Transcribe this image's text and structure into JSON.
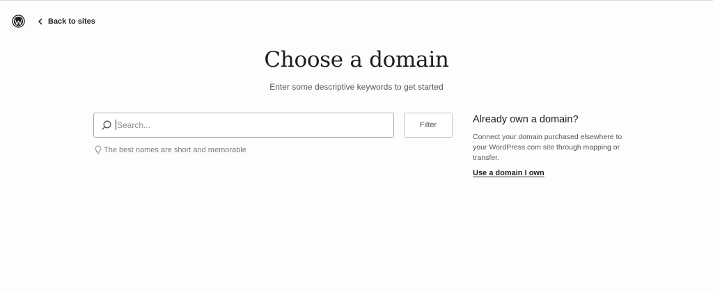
{
  "header": {
    "logo_icon": "wordpress-logo-icon",
    "back_icon": "chevron-left-icon",
    "back_label": "Back to sites"
  },
  "main": {
    "title": "Choose a domain",
    "subtitle": "Enter some descriptive keywords to get started",
    "search": {
      "icon": "search-icon",
      "value": "",
      "placeholder": "Search..."
    },
    "filter_label": "Filter",
    "hint": {
      "icon": "lightbulb-icon",
      "text": "The best names are short and memorable"
    }
  },
  "aside": {
    "title": "Already own a domain?",
    "description": "Connect your domain purchased elsewhere to your WordPress.com site through mapping or transfer.",
    "link_label": "Use a domain I own"
  },
  "colors": {
    "text": "#1e1e1e",
    "muted": "#50575e",
    "placeholder": "#8c8f94",
    "border": "#a7aaad",
    "background": "#fdfdfd"
  }
}
